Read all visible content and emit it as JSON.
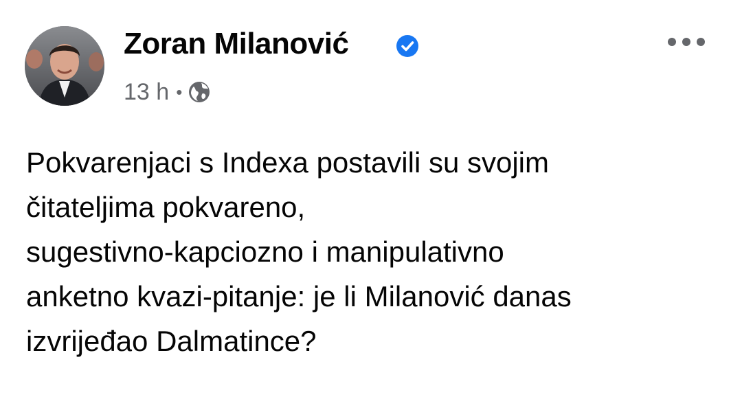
{
  "post": {
    "author": {
      "name": "Zoran Milanović",
      "verified": true,
      "verified_icon": "verified-badge-icon",
      "avatar_icon": "profile-photo"
    },
    "meta": {
      "time": "13 h",
      "separator": "•",
      "audience_icon": "globe-icon"
    },
    "menu_icon": "more-options-icon",
    "text_lines": [
      "Pokvarenjaci s Indexa postavili su svojim",
      "čitateljima pokvareno,",
      "sugestivno-kapciozno i manipulativno",
      "anketno kvazi-pitanje: je li Milanović danas",
      "izvrijeđao Dalmatince?"
    ]
  },
  "colors": {
    "text": "#050505",
    "secondary_text": "#65676b",
    "verified_blue": "#1877f2",
    "background": "#ffffff"
  }
}
